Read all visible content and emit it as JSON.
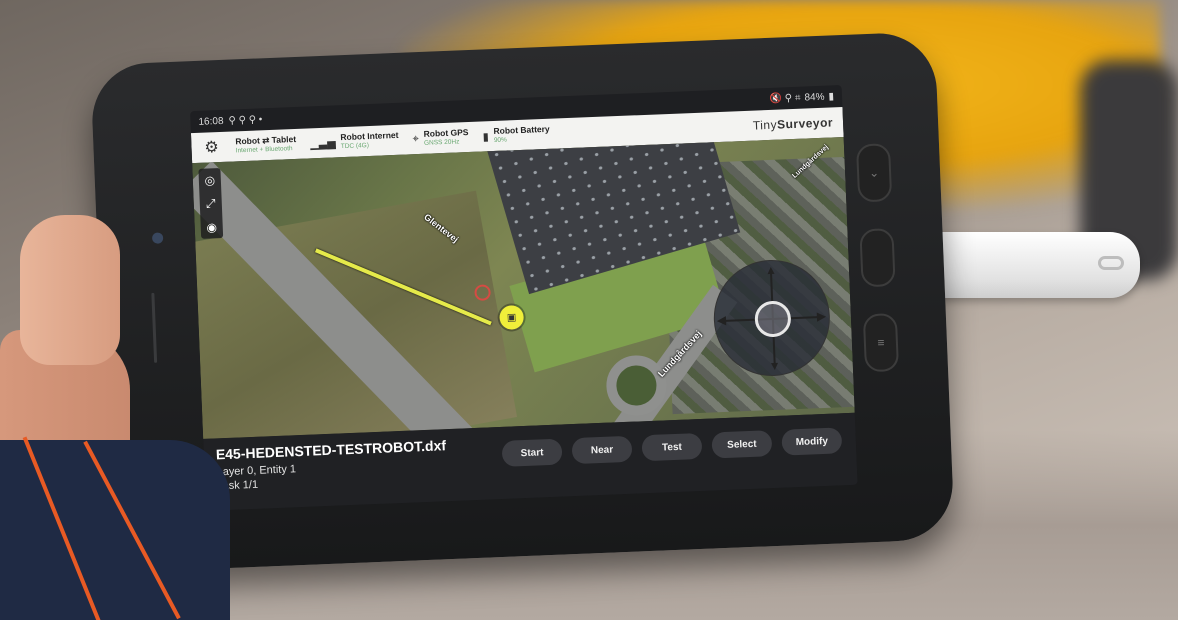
{
  "status_bar": {
    "time": "16:08",
    "left_icons": "⚲ ⚲ ⚲ •",
    "right_icons": "🔇 ⚲ ⌗",
    "battery": "84%"
  },
  "top_bar": {
    "settings_icon": "gear-icon",
    "robot_tablet": {
      "title": "Robot ⇄ Tablet",
      "subtitle": "Internet + Bluetooth"
    },
    "robot_internet": {
      "title": "Robot Internet",
      "subtitle": "TDC (4G)"
    },
    "robot_gps": {
      "title": "Robot GPS",
      "subtitle": "GNSS 20Hz"
    },
    "robot_battery": {
      "title": "Robot Battery",
      "subtitle": "90%"
    },
    "brand_prefix": "Tiny",
    "brand_suffix": "Surveyor"
  },
  "map": {
    "road_label_1": "Glentevej",
    "road_label_2": "Lundgårdsvej",
    "road_label_3": "Lundgårdsvej"
  },
  "bottom": {
    "file_name": "E45-HEDENSTED-TESTROBOT.dxf",
    "layer_entity": "Layer 0, Entity 1",
    "task": "Task 1/1",
    "buttons": [
      "Start",
      "Near",
      "Test",
      "Select",
      "Modify"
    ]
  },
  "colors": {
    "accent_line": "#e5ea4a",
    "status_ok": "#6aa872",
    "topbar_bg": "#f3f3f1",
    "panel_bg": "#202124"
  }
}
